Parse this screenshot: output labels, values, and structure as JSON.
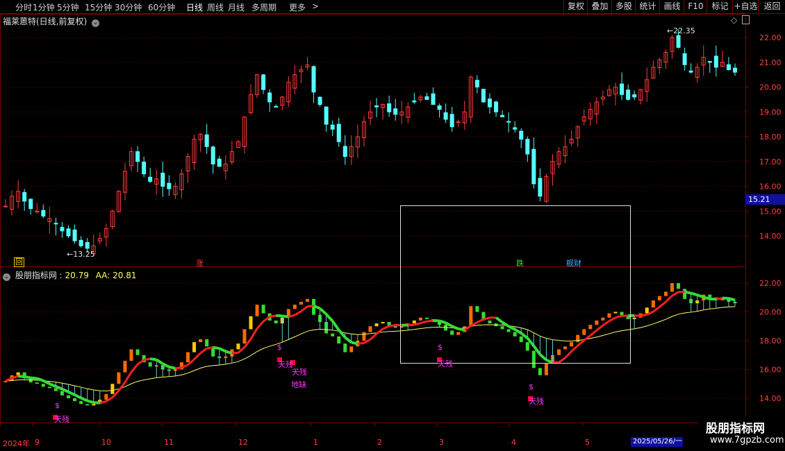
{
  "toolbar": {
    "periods": [
      "分时",
      "1分钟",
      "5分钟",
      "15分钟",
      "30分钟",
      "60分钟",
      "日线",
      "周线",
      "月线",
      "多周期",
      "更多"
    ],
    "more_arrow": ">",
    "active_period": "日线",
    "buttons": [
      "复权",
      "叠加",
      "多股",
      "统计",
      "画线",
      "F10",
      "标记",
      "+自选",
      "返回"
    ]
  },
  "main_chart": {
    "title": "福莱蒽特(日线,前复权)",
    "y_ticks": [
      "22.00",
      "21.00",
      "20.00",
      "19.00",
      "18.00",
      "17.00",
      "16.00",
      "15.00",
      "14.00"
    ],
    "current_price": "15.21",
    "high_label": "22.35",
    "low_label": "13.25",
    "markers": [
      {
        "text": "回",
        "color": "#ffcc00"
      },
      {
        "text": "涨",
        "color": "#ff3b3b"
      },
      {
        "text": "跌",
        "color": "#33dd33"
      },
      {
        "text": "舰财",
        "color": "#33bbff"
      }
    ]
  },
  "indicator": {
    "name": "股朋指标网",
    "value1": "20.79",
    "aa_label": "AA:",
    "aa_value": "20.81",
    "y_ticks": [
      "22.00",
      "20.00",
      "18.00",
      "16.00",
      "14.00"
    ],
    "signals": [
      "天残",
      "天残",
      "天残",
      "地缺",
      "天残",
      "天残"
    ],
    "dollar": "$"
  },
  "x_axis": {
    "labels": [
      "2024年",
      "9",
      "10",
      "11",
      "12",
      "1",
      "2",
      "3",
      "4",
      "5"
    ],
    "date_box": "2025/05/26/一"
  },
  "watermark": {
    "line1": "股朋指标网",
    "line2": "www.7gpzb.com"
  },
  "colors": {
    "up": "#ff3b3b",
    "down": "#54ffff",
    "grid": "#7a0000",
    "ma_line": "#ff2020",
    "ma_down": "#33dd33",
    "aa_line": "#ffff66"
  },
  "chart_data": {
    "type": "candlestick",
    "price_axis": {
      "min": 13.0,
      "max": 22.6
    },
    "indicator_axis": {
      "min": 13.0,
      "max": 22.6
    },
    "closes": [
      15.2,
      15.6,
      15.8,
      15.4,
      15.1,
      15.0,
      14.8,
      14.7,
      14.5,
      14.2,
      14.0,
      13.8,
      13.6,
      13.5,
      13.6,
      13.9,
      14.3,
      15.0,
      15.8,
      16.6,
      17.4,
      17.0,
      16.5,
      16.2,
      16.3,
      16.0,
      15.9,
      16.0,
      16.5,
      17.2,
      17.9,
      18.1,
      17.6,
      16.9,
      16.8,
      16.9,
      17.4,
      17.8,
      18.8,
      19.7,
      20.5,
      19.9,
      19.4,
      19.2,
      19.6,
      20.2,
      20.5,
      20.7,
      20.9,
      19.8,
      19.3,
      18.5,
      18.3,
      17.8,
      17.2,
      17.6,
      18.0,
      18.6,
      19.0,
      19.2,
      19.3,
      19.0,
      18.9,
      19.0,
      19.2,
      19.4,
      19.6,
      19.5,
      19.3,
      19.1,
      18.7,
      18.4,
      18.6,
      19.0,
      20.4,
      20.0,
      19.4,
      19.2,
      19.0,
      18.8,
      18.6,
      18.3,
      17.9,
      17.3,
      16.1,
      15.6,
      16.4,
      17.0,
      17.4,
      17.6,
      17.9,
      18.4,
      18.8,
      19.1,
      19.4,
      19.6,
      19.9,
      20.0,
      19.7,
      19.5,
      19.6,
      19.9,
      20.3,
      20.8,
      21.1,
      21.4,
      22.0,
      21.6,
      20.9,
      20.6,
      20.8,
      21.2,
      21.0,
      20.8,
      21.0,
      20.7,
      20.6
    ],
    "x_labels": [
      "2024年",
      "9",
      "10",
      "11",
      "12",
      "1",
      "2",
      "3",
      "4",
      "5"
    ]
  }
}
